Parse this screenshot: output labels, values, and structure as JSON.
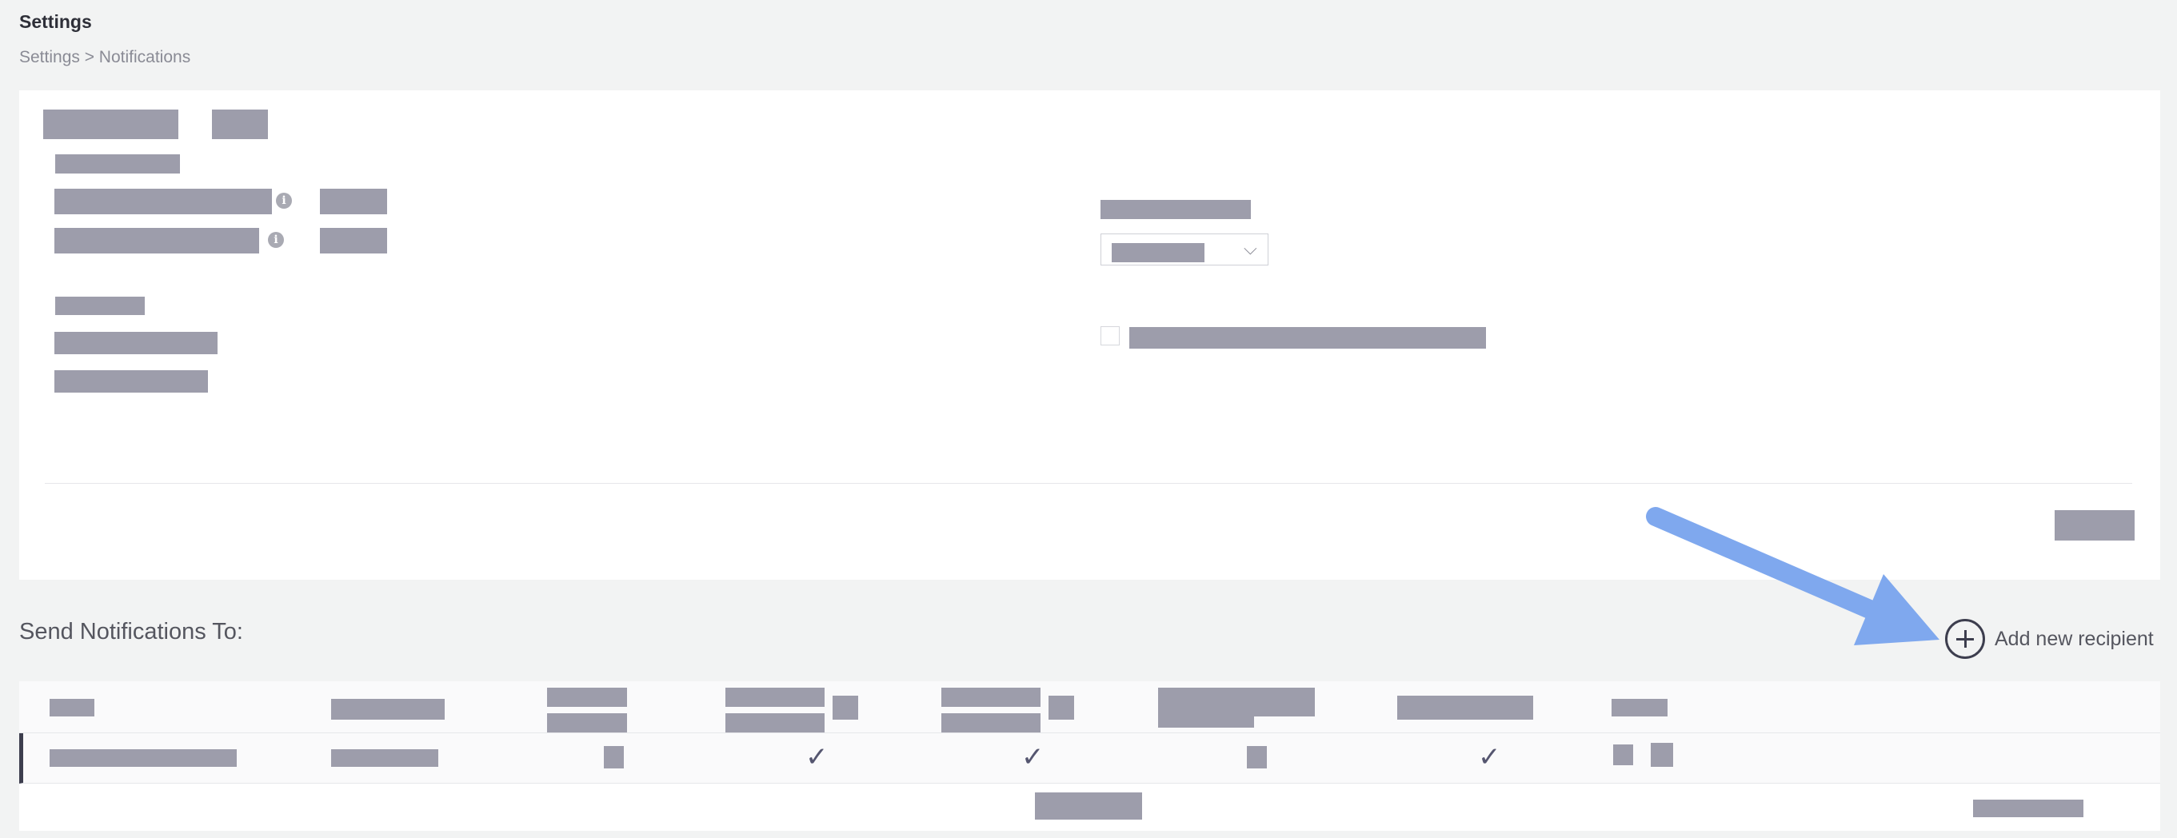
{
  "page": {
    "title": "Settings",
    "breadcrumb": "Settings > Notifications"
  },
  "recipients": {
    "section_title": "Send Notifications To:",
    "add_label": "Add new recipient",
    "row_checks": [
      "✓",
      "✓",
      "✓"
    ]
  },
  "icons": {
    "info": "i",
    "chevron": "⌵"
  },
  "colors": {
    "accent": "#3d3e4e",
    "redacted": "#9d9dab",
    "background": "#f2f3f3",
    "card": "#ffffff"
  }
}
